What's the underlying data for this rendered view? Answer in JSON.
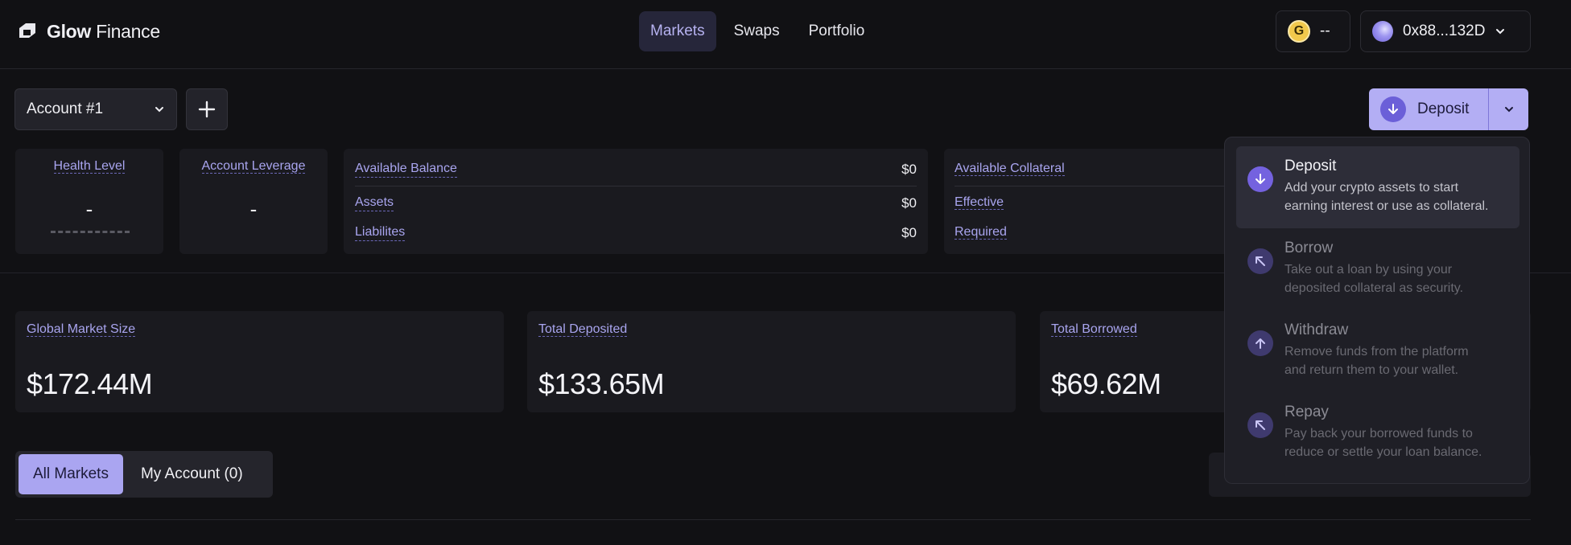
{
  "app": {
    "brand_bold": "Glow",
    "brand_rest": " Finance"
  },
  "nav": {
    "items": [
      "Markets",
      "Swaps",
      "Portfolio"
    ],
    "active": "Markets"
  },
  "header": {
    "token_balance": "--",
    "wallet_address": "0x88...132D"
  },
  "account": {
    "selected": "Account #1"
  },
  "deposit_button": {
    "label": "Deposit"
  },
  "health": {
    "label": "Health Level",
    "value": "-"
  },
  "leverage": {
    "label": "Account Leverage",
    "value": "-"
  },
  "balance": {
    "rows": [
      {
        "label": "Available Balance",
        "value": "$0"
      },
      {
        "label": "Assets",
        "value": "$0"
      },
      {
        "label": "Liabilites",
        "value": "$0"
      }
    ]
  },
  "collateral": {
    "rows": [
      {
        "label": "Available Collateral"
      },
      {
        "label": "Effective"
      },
      {
        "label": "Required"
      }
    ]
  },
  "stats": [
    {
      "label": "Global Market Size",
      "value": "$172.44M"
    },
    {
      "label": "Total Deposited",
      "value": "$133.65M"
    },
    {
      "label": "Total Borrowed",
      "value": "$69.62M"
    }
  ],
  "tabs": [
    {
      "label": "All Markets",
      "active": true
    },
    {
      "label": "My Account (0)",
      "active": false
    }
  ],
  "deposit_menu": {
    "items": [
      {
        "title": "Deposit",
        "desc1": "Add your crypto assets to start",
        "desc2": "earning interest or use as collateral.",
        "icon": "arrow-down-icon"
      },
      {
        "title": "Borrow",
        "desc1": "Take out a loan by using your",
        "desc2": "deposited collateral as security.",
        "icon": "arrow-up-left-icon"
      },
      {
        "title": "Withdraw",
        "desc1": "Remove funds from the platform",
        "desc2": "and return them to your wallet.",
        "icon": "arrow-up-icon"
      },
      {
        "title": "Repay",
        "desc1": "Pay back your borrowed funds to",
        "desc2": "reduce or settle your loan balance.",
        "icon": "arrow-up-left-icon"
      }
    ]
  },
  "colors": {
    "background": "#111114",
    "accent": "#b3aef4",
    "accent_dark": "#6b5fd8",
    "label": "#a9a5ef"
  }
}
